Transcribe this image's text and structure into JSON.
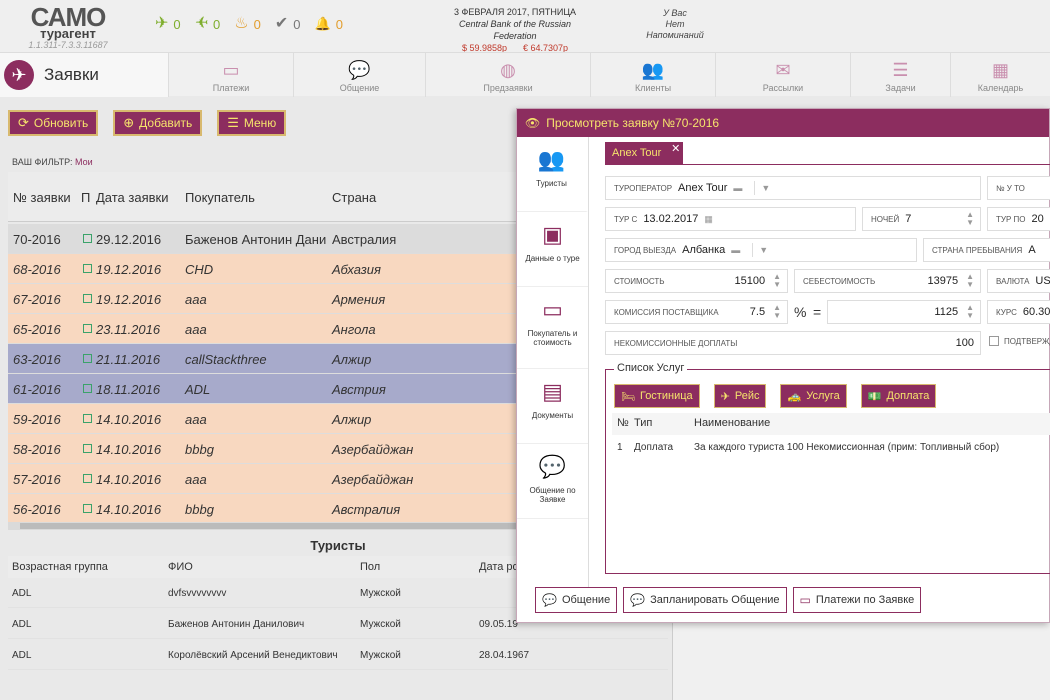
{
  "app": {
    "logo_main": "САМО",
    "logo_sub": "турагент",
    "version": "1.1.311-7.3.3.11687",
    "counters": [
      {
        "icon": "plane-out-icon",
        "glyph": "✈",
        "value": "0"
      },
      {
        "icon": "plane-in-icon",
        "glyph": "✈",
        "value": "0"
      },
      {
        "icon": "cake-icon",
        "glyph": "♨",
        "value": "0"
      },
      {
        "icon": "check-icon",
        "glyph": "✔",
        "value": "0"
      },
      {
        "icon": "bell-icon",
        "glyph": "🔔",
        "value": "0"
      }
    ],
    "date": "3 ФЕВРАЛЯ 2017, ПЯТНИЦА",
    "bank": "Central Bank of the Russian Federation",
    "usd": "$ 59.9858р",
    "eur": "€ 64.7307р",
    "reminders": [
      "У Вас",
      "Нет",
      "Напоминаний"
    ]
  },
  "nav": {
    "active_title": "Заявки",
    "items": [
      {
        "label": "Платежи",
        "icon": "card-icon",
        "glyph": "▭"
      },
      {
        "label": "Общение",
        "icon": "chat-icon",
        "glyph": "💬"
      },
      {
        "label": "Предзаявки",
        "icon": "globe-icon",
        "glyph": "◍"
      },
      {
        "label": "Клиенты",
        "icon": "users-icon",
        "glyph": "👥"
      },
      {
        "label": "Рассылки",
        "icon": "envelope-icon",
        "glyph": "✉"
      },
      {
        "label": "Задачи",
        "icon": "tasks-icon",
        "glyph": "☰"
      },
      {
        "label": "Календарь",
        "icon": "calendar-icon",
        "glyph": "▦"
      }
    ]
  },
  "toolbar": {
    "refresh": "Обновить",
    "add": "Добавить",
    "menu": "Меню"
  },
  "filter": {
    "label": "ВАШ ФИЛЬТР:",
    "value": "Мои"
  },
  "grid": {
    "headers": {
      "num": "№ заявки",
      "p": "П",
      "date": "Дата заявки",
      "buyer": "Покупатель",
      "country": "Страна"
    },
    "rows": [
      {
        "num": "70-2016",
        "date": "29.12.2016",
        "buyer": "Баженов Антонин Дани",
        "country": "Австралия",
        "style": "sel"
      },
      {
        "num": "68-2016",
        "date": "19.12.2016",
        "buyer": "CHD",
        "country": "Абхазия",
        "style": "orange"
      },
      {
        "num": "67-2016",
        "date": "19.12.2016",
        "buyer": "aaa",
        "country": "Армения",
        "style": "orange"
      },
      {
        "num": "65-2016",
        "date": "23.11.2016",
        "buyer": "aaa",
        "country": "Ангола",
        "style": "orange"
      },
      {
        "num": "63-2016",
        "date": "21.11.2016",
        "buyer": "callStackthree",
        "country": "Алжир",
        "style": "blue"
      },
      {
        "num": "61-2016",
        "date": "18.11.2016",
        "buyer": "ADL",
        "country": "Австрия",
        "style": "blue"
      },
      {
        "num": "59-2016",
        "date": "14.10.2016",
        "buyer": "aaa",
        "country": "Алжир",
        "style": "orange"
      },
      {
        "num": "58-2016",
        "date": "14.10.2016",
        "buyer": "bbbg",
        "country": "Азербайджан",
        "style": "orange"
      },
      {
        "num": "57-2016",
        "date": "14.10.2016",
        "buyer": "aaa",
        "country": "Азербайджан",
        "style": "orange"
      },
      {
        "num": "56-2016",
        "date": "14.10.2016",
        "buyer": "bbbg",
        "country": "Австралия",
        "style": "orange"
      }
    ]
  },
  "tourists": {
    "title": "Туристы",
    "headers": {
      "age": "Возрастная группа",
      "name": "ФИО",
      "sex": "Пол",
      "dob": "Дата ро"
    },
    "rows": [
      {
        "age": "ADL",
        "name": "dvfsvvvvvvvv",
        "sex": "Мужской",
        "dob": ""
      },
      {
        "age": "ADL",
        "name": "Баженов Антонин Данилович",
        "sex": "Мужской",
        "dob": "09.05.19"
      },
      {
        "age": "ADL",
        "name": "Королёвский Арсений Венедиктович",
        "sex": "Мужской",
        "dob": "28.04.1967"
      }
    ]
  },
  "modal": {
    "title": "Просмотреть заявку №70-2016",
    "tab": "Anex Tour",
    "sidebar": [
      {
        "label": "Туристы",
        "icon": "users-icon",
        "glyph": "👥"
      },
      {
        "label": "Данные о туре",
        "icon": "image-icon",
        "glyph": "▣"
      },
      {
        "label": "Покупатель и стоимость",
        "icon": "card-icon",
        "glyph": "▭"
      },
      {
        "label": "Документы",
        "icon": "document-icon",
        "glyph": "▤"
      },
      {
        "label": "Общение по Заявке",
        "icon": "chat-icon",
        "glyph": "💬"
      }
    ],
    "fields": {
      "operator_label": "Туроператор",
      "operator": "Anex Tour",
      "num_label": "№ у то",
      "tour_from_label": "Тур с",
      "tour_from": "13.02.2017",
      "nights_label": "ночей",
      "nights": "7",
      "tour_to_label": "Тур по",
      "tour_to": "20",
      "city_label": "Город выезда",
      "city": "Албанка",
      "country_label": "Страна пребывания",
      "country": "А",
      "cost_label": "Стоимость",
      "cost": "15100",
      "selfcost_label": "Себестоимость",
      "selfcost": "13975",
      "currency_label": "Валюта",
      "currency": "US",
      "commission_label": "Комиссия поставщика",
      "commission": "7.5",
      "pct": "%",
      "eq": "=",
      "commission_sum": "1125",
      "rate_label": "Курс",
      "rate": "60.30",
      "noncomm_label": "Некомиссионные доплаты",
      "noncomm": "100",
      "confirm_label": "Подтвержд"
    },
    "services": {
      "legend": "Список Услуг",
      "buttons": [
        {
          "label": "Гостиница",
          "icon": "bed-icon",
          "glyph": "🛏"
        },
        {
          "label": "Рейс",
          "icon": "plane-icon",
          "glyph": "✈"
        },
        {
          "label": "Услуга",
          "icon": "taxi-icon",
          "glyph": "🚕"
        },
        {
          "label": "Доплата",
          "icon": "money-icon",
          "glyph": "💵"
        }
      ],
      "headers": {
        "num": "№",
        "type": "Тип",
        "name": "Наименование"
      },
      "rows": [
        {
          "num": "1",
          "type": "Доплата",
          "name": "За каждого туриста 100 Некомиссионная (прим: Топливный сбор)"
        }
      ]
    },
    "footer": {
      "chat": "Общение",
      "plan": "Запланировать Общение",
      "payments": "Платежи по Заявке"
    }
  }
}
